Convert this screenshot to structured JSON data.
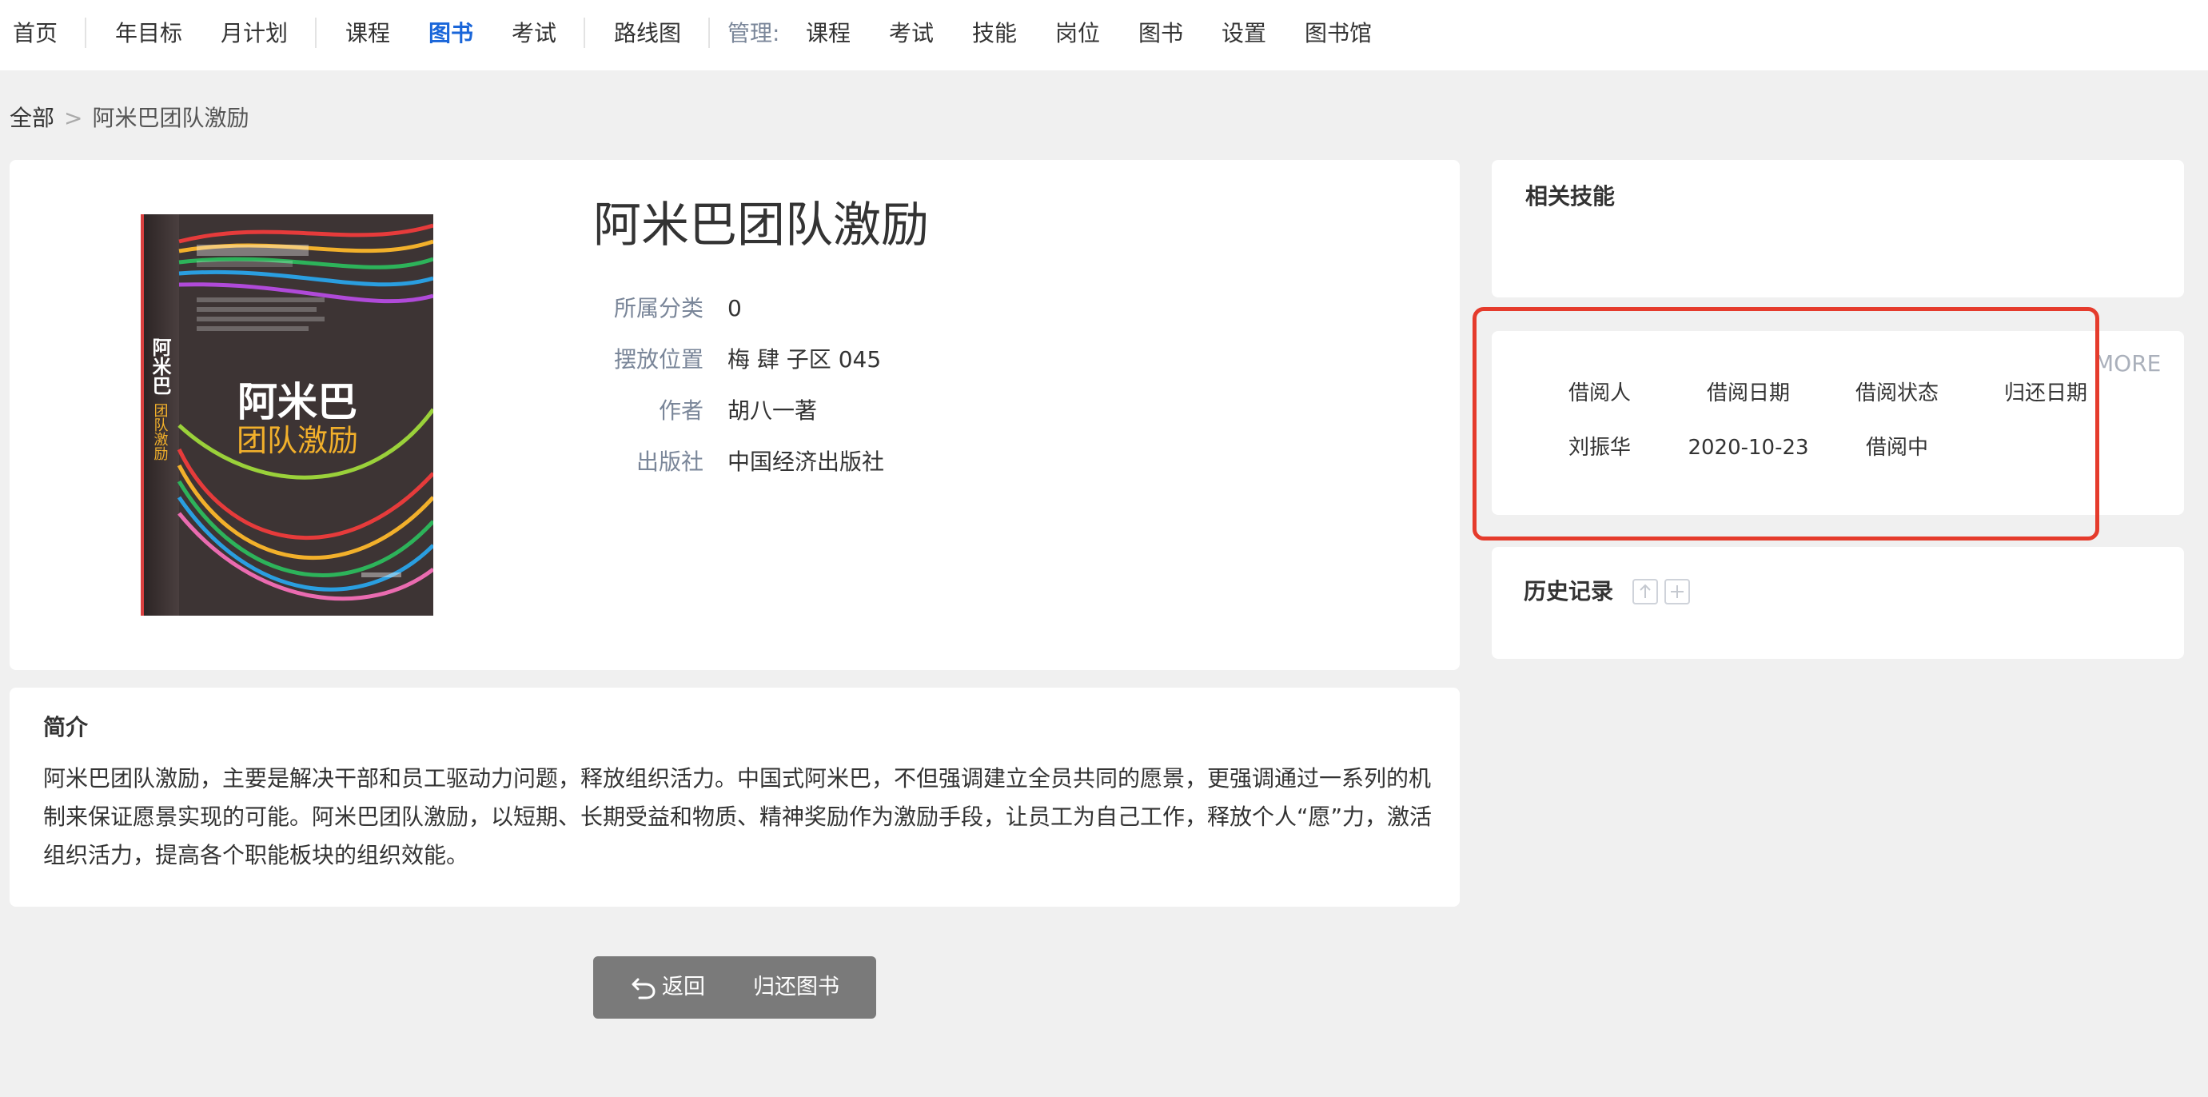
{
  "nav": {
    "items": [
      "首页",
      "年目标",
      "月计划",
      "课程",
      "图书",
      "考试",
      "路线图"
    ],
    "active": "图书",
    "manage_label": "管理:",
    "manage_items": [
      "课程",
      "考试",
      "技能",
      "岗位",
      "图书",
      "设置",
      "图书馆"
    ]
  },
  "breadcrumb": {
    "root": "全部",
    "separator": ">",
    "current": "阿米巴团队激励"
  },
  "book": {
    "title": "阿米巴团队激励",
    "fields": [
      {
        "label": "所属分类",
        "value": "0"
      },
      {
        "label": "摆放位置",
        "value": "梅 肆 子区 045"
      },
      {
        "label": "作者",
        "value": "胡八一著"
      },
      {
        "label": "出版社",
        "value": "中国经济出版社"
      }
    ],
    "cover": {
      "title": "阿米巴",
      "subtitle": "团队激励",
      "colors": {
        "bg": "#3d3434",
        "title": "#ffffff",
        "subtitle": "#f2b02b"
      }
    }
  },
  "intro": {
    "title": "简介",
    "text": "阿米巴团队激励，主要是解决干部和员工驱动力问题，释放组织活力。中国式阿米巴，不但强调建立全员共同的愿景，更强调通过一系列的机制来保证愿景实现的可能。阿米巴团队激励，以短期、长期受益和物质、精神奖励作为激励手段，让员工为自己工作，释放个人“愿”力，激活组织活力，提高各个职能板块的组织效能。"
  },
  "skills": {
    "title": "相关技能"
  },
  "borrow": {
    "more": "MORE",
    "headers": [
      "借阅人",
      "借阅日期",
      "借阅状态",
      "归还日期"
    ],
    "rows": [
      {
        "borrower": "刘振华",
        "date": "2020-10-23",
        "status": "借阅中",
        "return_date": ""
      }
    ]
  },
  "history": {
    "title": "历史记录",
    "icons": [
      "arrow-up-icon",
      "plus-icon"
    ]
  },
  "actions": {
    "back": "返回",
    "return_book": "归还图书"
  },
  "colors": {
    "accent": "#1a66d9",
    "highlight": "#e53b2c",
    "button_bg": "#7a7a7a"
  }
}
